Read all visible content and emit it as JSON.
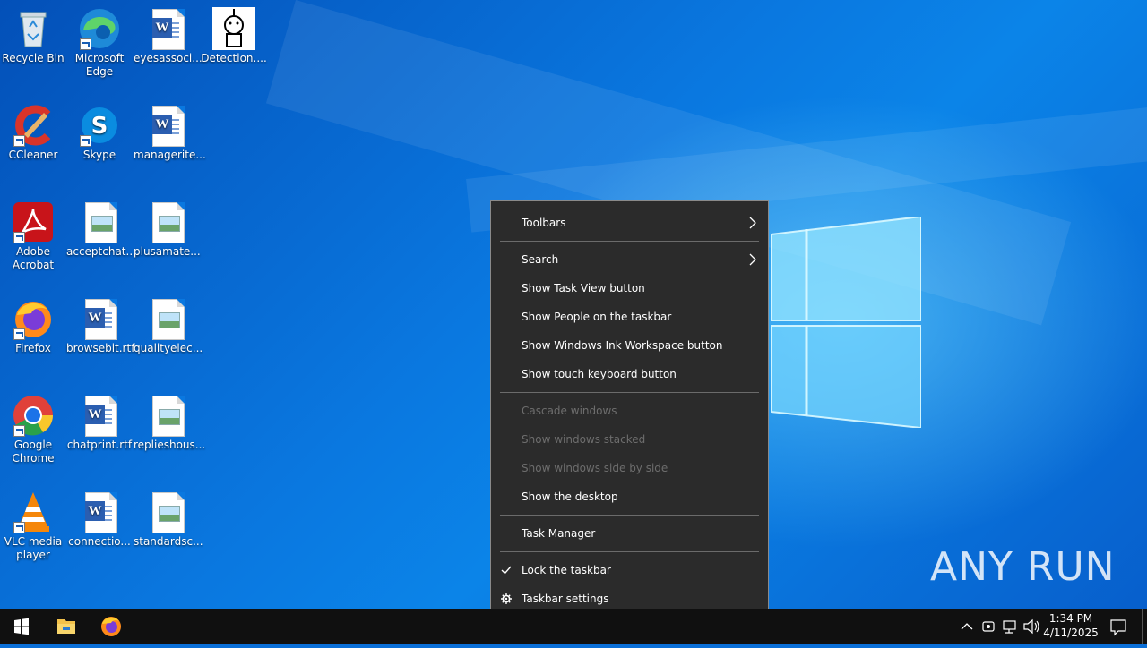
{
  "desktop": {
    "icons": [
      {
        "label": "Recycle Bin",
        "icon": "recycle-bin-icon"
      },
      {
        "label": "Microsoft Edge",
        "icon": "edge-icon"
      },
      {
        "label": "eyesassoci...",
        "icon": "word-doc-icon"
      },
      {
        "label": "Detection....",
        "icon": "image-file-icon"
      },
      {
        "label": "CCleaner",
        "icon": "ccleaner-icon"
      },
      {
        "label": "Skype",
        "icon": "skype-icon"
      },
      {
        "label": "managerite...",
        "icon": "word-doc-icon"
      },
      {
        "label": "Adobe Acrobat",
        "icon": "acrobat-icon"
      },
      {
        "label": "acceptchat....",
        "icon": "image-file-icon"
      },
      {
        "label": "plusamate...",
        "icon": "image-file-icon"
      },
      {
        "label": "Firefox",
        "icon": "firefox-icon"
      },
      {
        "label": "browsebit.rtf",
        "icon": "word-doc-icon"
      },
      {
        "label": "qualityelec...",
        "icon": "image-file-icon"
      },
      {
        "label": "Google Chrome",
        "icon": "chrome-icon"
      },
      {
        "label": "chatprint.rtf",
        "icon": "word-doc-icon"
      },
      {
        "label": "replieshous...",
        "icon": "image-file-icon"
      },
      {
        "label": "VLC media player",
        "icon": "vlc-icon"
      },
      {
        "label": "connectio...",
        "icon": "word-doc-icon"
      },
      {
        "label": "standardsc...",
        "icon": "image-file-icon"
      }
    ]
  },
  "context_menu": {
    "items": [
      {
        "label": "Toolbars",
        "submenu": true,
        "enabled": true
      },
      {
        "label": "Search",
        "submenu": true,
        "enabled": true
      },
      {
        "label": "Show Task View button",
        "enabled": true
      },
      {
        "label": "Show People on the taskbar",
        "enabled": true
      },
      {
        "label": "Show Windows Ink Workspace button",
        "enabled": true
      },
      {
        "label": "Show touch keyboard button",
        "enabled": true
      },
      {
        "label": "Cascade windows",
        "enabled": false
      },
      {
        "label": "Show windows stacked",
        "enabled": false
      },
      {
        "label": "Show windows side by side",
        "enabled": false
      },
      {
        "label": "Show the desktop",
        "enabled": true
      },
      {
        "label": "Task Manager",
        "enabled": true
      },
      {
        "label": "Lock the taskbar",
        "enabled": true,
        "checked": true
      },
      {
        "label": "Taskbar settings",
        "enabled": true,
        "icon": "gear-icon"
      }
    ]
  },
  "taskbar": {
    "pinned": [
      "windows-start-icon",
      "file-explorer-icon",
      "firefox-icon"
    ],
    "tray_icons": [
      "chevron-up-icon",
      "meet-now-icon",
      "network-icon",
      "volume-icon"
    ],
    "time": "1:34 PM",
    "date": "4/11/2025",
    "notification_icon": "action-center-icon"
  },
  "watermark": {
    "text": "ANY RUN"
  },
  "colors": {
    "menu_bg": "#2b2b2b",
    "taskbar_bg": "#101010",
    "accent": "#0a78e0"
  }
}
